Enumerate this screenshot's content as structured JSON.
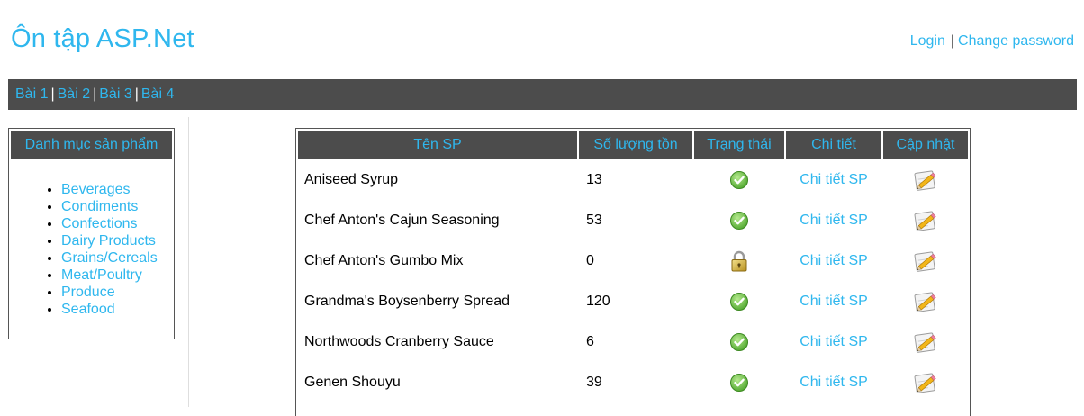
{
  "header": {
    "title": "Ôn tập ASP.Net",
    "login_label": "Login",
    "separator": "|",
    "change_password_label": "Change password"
  },
  "nav": {
    "items": [
      {
        "label": "Bài 1"
      },
      {
        "label": "Bài 2"
      },
      {
        "label": "Bài 3"
      },
      {
        "label": "Bài 4"
      }
    ],
    "separator": "|"
  },
  "categories": {
    "title": "Danh mục sản phẩm",
    "items": [
      "Beverages",
      "Condiments",
      "Confections",
      "Dairy Products",
      "Grains/Cereals",
      "Meat/Poultry",
      "Produce",
      "Seafood"
    ]
  },
  "products": {
    "columns": [
      "Tên SP",
      "Số lượng tồn",
      "Trạng thái",
      "Chi tiết",
      "Cập nhật"
    ],
    "rows": [
      {
        "name": "Aniseed Syrup",
        "qty": "13",
        "status_icon": "check-circle-icon",
        "detail": "Chi tiết SP",
        "edit_icon": "pencil-note-icon"
      },
      {
        "name": "Chef Anton's Cajun Seasoning",
        "qty": "53",
        "status_icon": "check-circle-icon",
        "detail": "Chi tiết SP",
        "edit_icon": "pencil-note-icon"
      },
      {
        "name": "Chef Anton's Gumbo Mix",
        "qty": "0",
        "status_icon": "lock-icon",
        "detail": "Chi tiết SP",
        "edit_icon": "pencil-note-icon"
      },
      {
        "name": "Grandma's Boysenberry Spread",
        "qty": "120",
        "status_icon": "check-circle-icon",
        "detail": "Chi tiết SP",
        "edit_icon": "pencil-note-icon"
      },
      {
        "name": "Northwoods Cranberry Sauce",
        "qty": "6",
        "status_icon": "check-circle-icon",
        "detail": "Chi tiết SP",
        "edit_icon": "pencil-note-icon"
      },
      {
        "name": "Genen Shouyu",
        "qty": "39",
        "status_icon": "check-circle-icon",
        "detail": "Chi tiết SP",
        "edit_icon": "pencil-note-icon"
      }
    ]
  },
  "colors": {
    "link": "#2fb7ee",
    "bar": "#4c4c4c",
    "check_green": "#6cc04a"
  }
}
